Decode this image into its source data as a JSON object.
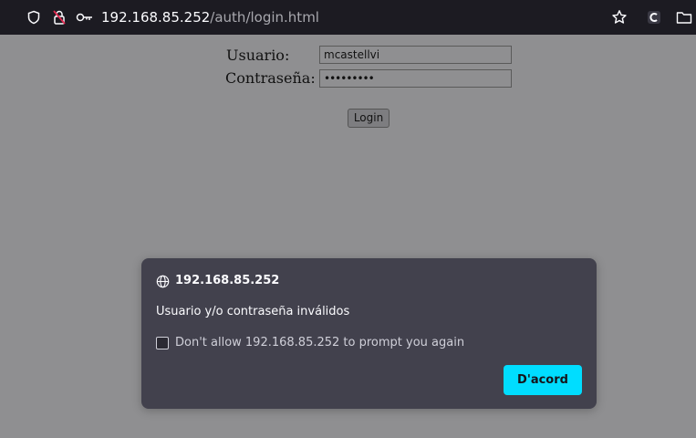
{
  "toolbar": {
    "url_host": "192.168.85.252",
    "url_path": "/auth/login.html",
    "icons": [
      "shield-icon",
      "insecure-lock-icon",
      "key-icon",
      "star-icon",
      "extension-icon",
      "folder-icon"
    ]
  },
  "form": {
    "username_label": "Usuario:",
    "username_value": "mcastellvi",
    "password_label": "Contraseña:",
    "password_value": "•••••••••",
    "login_label": "Login"
  },
  "dialog": {
    "origin": "192.168.85.252",
    "message": "Usuario y/o contraseña inválidos",
    "checkbox_label": "Don't allow 192.168.85.252 to prompt you again",
    "checkbox_checked": false,
    "ok_label": "D'acord",
    "accent_color": "#00ddff"
  }
}
